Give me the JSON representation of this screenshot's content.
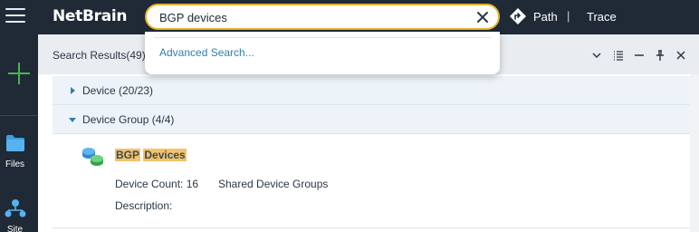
{
  "app": {
    "logo_text": "NetBrain"
  },
  "search": {
    "value": "BGP devices",
    "dropdown_item": "Advanced Search..."
  },
  "topbar": {
    "path_label": "Path",
    "separator": "|",
    "trace_label": "Trace"
  },
  "leftnav": {
    "files_label": "Files",
    "site_label": "Site"
  },
  "panel": {
    "title": "Search Results(49)",
    "groups": [
      {
        "label": "Device (20/23)",
        "expanded": false
      },
      {
        "label": "Device Group (4/4)",
        "expanded": true
      }
    ]
  },
  "result": {
    "name_part1": "BGP",
    "name_part2": "Devices",
    "device_count": "Device Count: 16",
    "group_type": "Shared Device Groups",
    "description": "Description:"
  },
  "colors": {
    "topbar_bg": "#1f2a36",
    "search_border": "#e7b42b",
    "highlight": "#f3c26a",
    "link": "#2f7fa9",
    "add_green": "#45b74a"
  },
  "icons": [
    "menu-icon",
    "close-icon",
    "path-icon",
    "add-icon",
    "folder-icon",
    "site-icon",
    "chevron-down-icon",
    "list-icon",
    "minimize-icon",
    "pin-icon",
    "close-icon",
    "caret-right-icon",
    "caret-down-icon",
    "device-group-icon"
  ]
}
